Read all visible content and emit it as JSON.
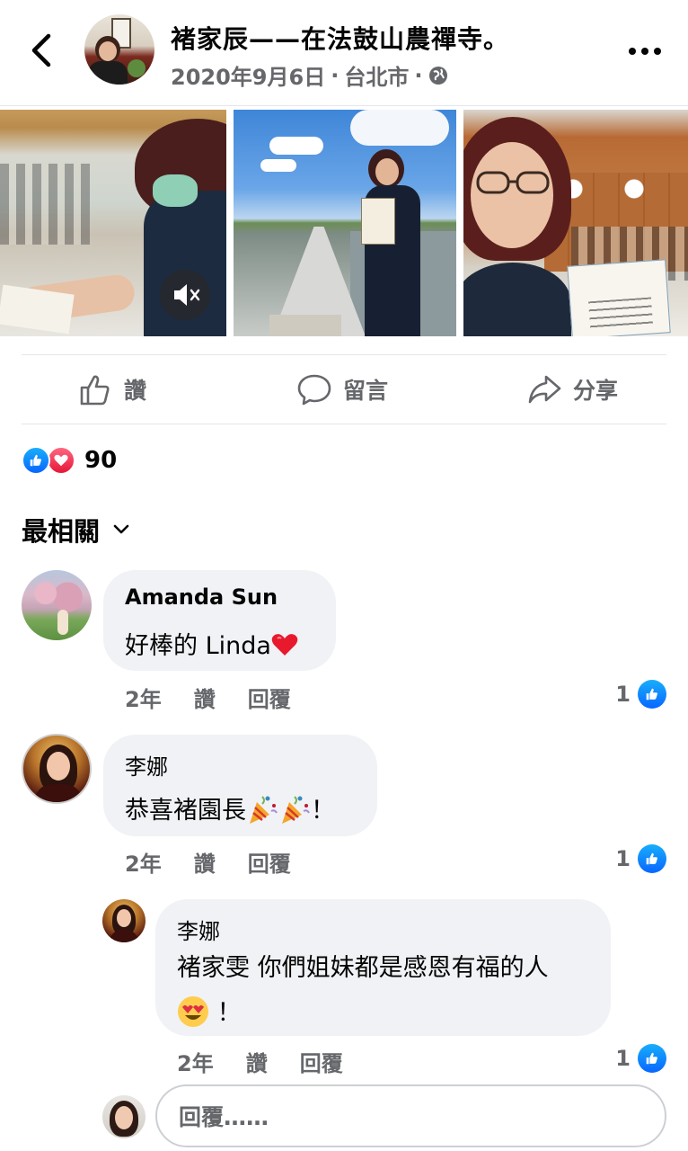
{
  "post": {
    "author_place": "褚家辰——在法鼓山農禪寺。",
    "date": "2020年9月6日",
    "location": "台北市",
    "separator": "·"
  },
  "actions": {
    "like": "讚",
    "comment": "留言",
    "share": "分享"
  },
  "reactions": {
    "count": "90"
  },
  "sort_label": "最相關",
  "comments": [
    {
      "author": "Amanda Sun",
      "text": "好棒的 Linda",
      "age": "2年",
      "like": "讚",
      "reply": "回覆",
      "likes": "1"
    },
    {
      "author": "李娜",
      "text_before": "恭喜褚園長",
      "text_after": "！",
      "age": "2年",
      "like": "讚",
      "reply": "回覆",
      "likes": "1"
    },
    {
      "author": "李娜",
      "text": "褚家雯 你們姐妹都是感恩有福的人",
      "text_after": "！",
      "age": "2年",
      "like": "讚",
      "reply": "回覆",
      "likes": "1"
    }
  ],
  "reply_box": {
    "placeholder": "回覆……"
  },
  "colors": {
    "facebook_blue": "#0866ff",
    "love_red": "#e61739",
    "secondary_text": "#65676b",
    "bubble_bg": "#f0f2f5"
  },
  "icons": [
    "back-chevron-icon",
    "globe-icon",
    "more-dots-icon",
    "mute-icon",
    "like-icon",
    "comment-icon",
    "share-icon",
    "heart-emoji-icon",
    "party-popper-emoji-icon",
    "heart-eyes-emoji-icon",
    "chevron-down-icon"
  ]
}
